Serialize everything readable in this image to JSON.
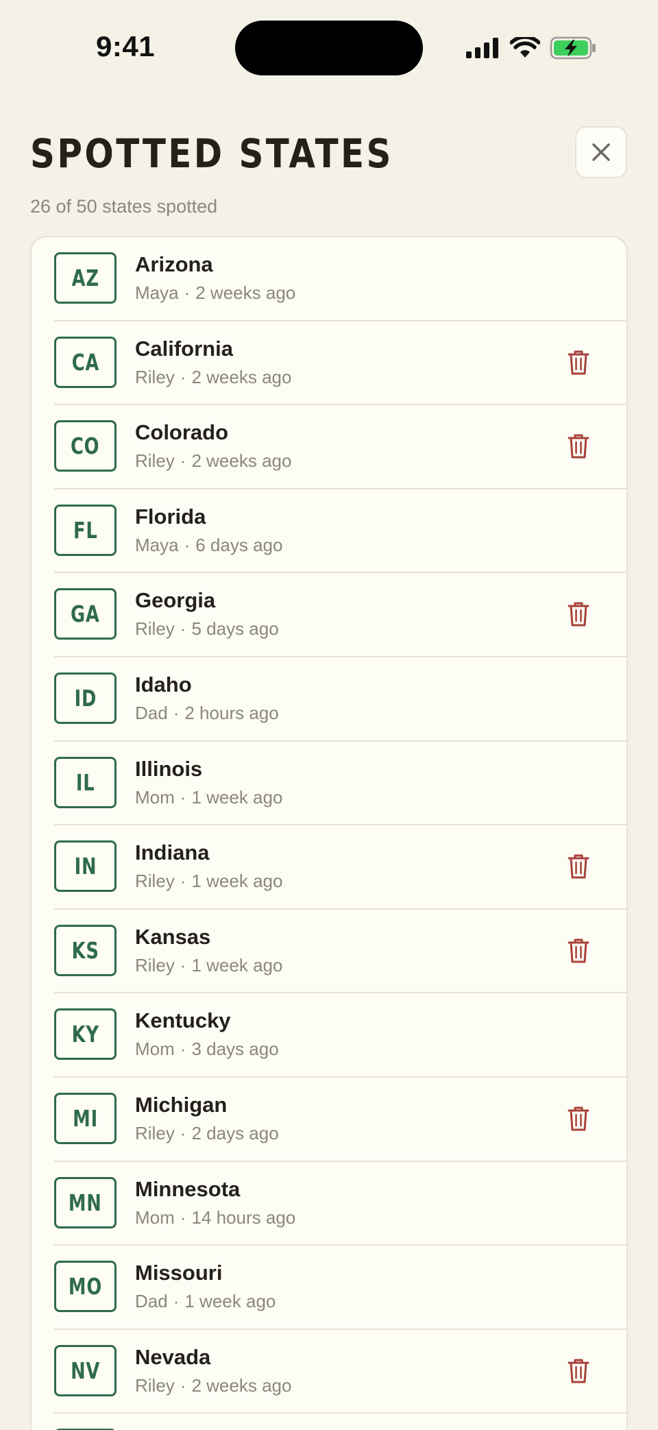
{
  "status_bar": {
    "time": "9:41"
  },
  "header": {
    "title": "SPOTTED STATES",
    "subtitle": "26 of 50 states spotted",
    "close_icon": "close-icon"
  },
  "colors": {
    "background": "#f4f1e6",
    "card": "#fdfcf5",
    "plate_green": "#2f6b4a",
    "delete_red": "#a8413a",
    "battery_green": "#3ccf5b"
  },
  "states": [
    {
      "code": "AZ",
      "name": "Arizona",
      "spotter": "Maya",
      "when": "2 weeks ago",
      "deletable": false
    },
    {
      "code": "CA",
      "name": "California",
      "spotter": "Riley",
      "when": "2 weeks ago",
      "deletable": true
    },
    {
      "code": "CO",
      "name": "Colorado",
      "spotter": "Riley",
      "when": "2 weeks ago",
      "deletable": true
    },
    {
      "code": "FL",
      "name": "Florida",
      "spotter": "Maya",
      "when": "6 days ago",
      "deletable": false
    },
    {
      "code": "GA",
      "name": "Georgia",
      "spotter": "Riley",
      "when": "5 days ago",
      "deletable": true
    },
    {
      "code": "ID",
      "name": "Idaho",
      "spotter": "Dad",
      "when": "2 hours ago",
      "deletable": false
    },
    {
      "code": "IL",
      "name": "Illinois",
      "spotter": "Mom",
      "when": "1 week ago",
      "deletable": false
    },
    {
      "code": "IN",
      "name": "Indiana",
      "spotter": "Riley",
      "when": "1 week ago",
      "deletable": true
    },
    {
      "code": "KS",
      "name": "Kansas",
      "spotter": "Riley",
      "when": "1 week ago",
      "deletable": true
    },
    {
      "code": "KY",
      "name": "Kentucky",
      "spotter": "Mom",
      "when": "3 days ago",
      "deletable": false
    },
    {
      "code": "MI",
      "name": "Michigan",
      "spotter": "Riley",
      "when": "2 days ago",
      "deletable": true
    },
    {
      "code": "MN",
      "name": "Minnesota",
      "spotter": "Mom",
      "when": "14 hours ago",
      "deletable": false
    },
    {
      "code": "MO",
      "name": "Missouri",
      "spotter": "Dad",
      "when": "1 week ago",
      "deletable": false
    },
    {
      "code": "NV",
      "name": "Nevada",
      "spotter": "Riley",
      "when": "2 weeks ago",
      "deletable": true
    }
  ]
}
